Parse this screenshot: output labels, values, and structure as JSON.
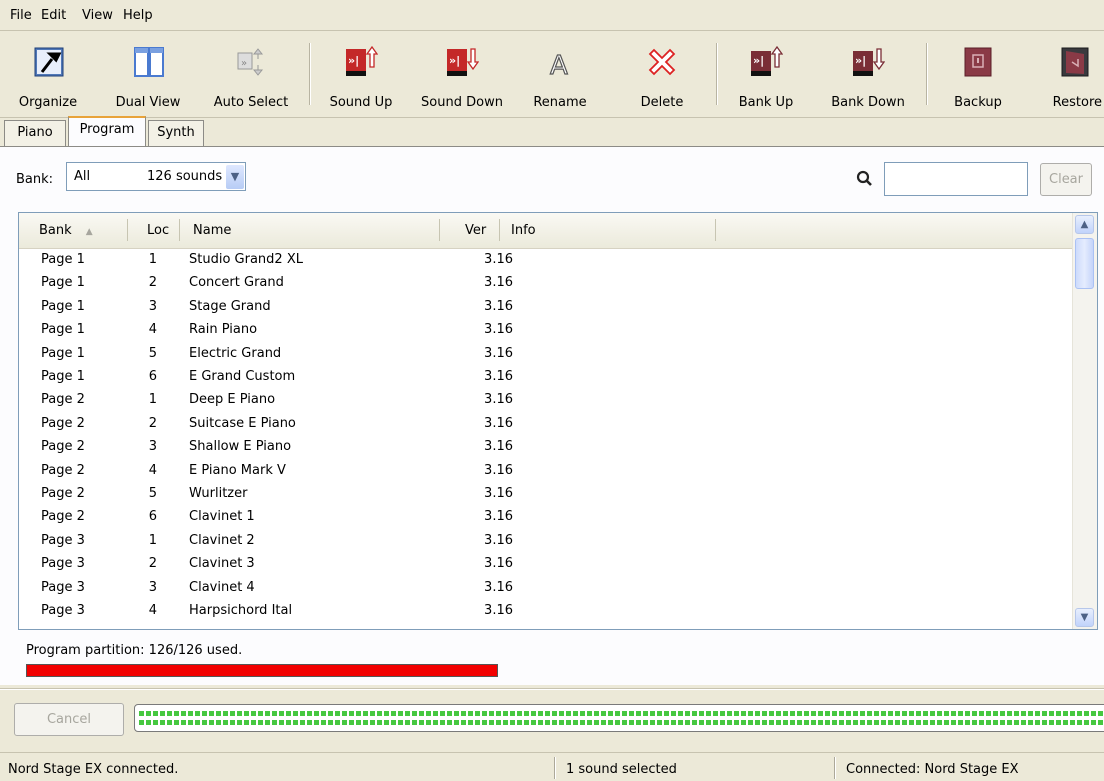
{
  "menu": [
    "File",
    "Edit",
    "View",
    "Help"
  ],
  "toolbar": {
    "organize": "Organize",
    "dual_view": "Dual View",
    "auto_select": "Auto Select",
    "sound_up": "Sound Up",
    "sound_down": "Sound Down",
    "rename": "Rename",
    "delete": "Delete",
    "bank_up": "Bank Up",
    "bank_down": "Bank Down",
    "backup": "Backup",
    "restore": "Restore"
  },
  "tabs": [
    "Piano",
    "Program",
    "Synth"
  ],
  "active_tab": "Program",
  "bank": {
    "label": "Bank:",
    "value": "All",
    "count": "126 sounds"
  },
  "search": {
    "value": "",
    "clear_label": "Clear"
  },
  "table": {
    "columns": {
      "bank": "Bank",
      "loc": "Loc",
      "name": "Name",
      "ver": "Ver",
      "info": "Info"
    },
    "rows": [
      {
        "bank": "Page 1",
        "loc": "1",
        "name": "Studio Grand2 XL",
        "ver": "3.16",
        "info": ""
      },
      {
        "bank": "Page 1",
        "loc": "2",
        "name": "Concert Grand",
        "ver": "3.16",
        "info": ""
      },
      {
        "bank": "Page 1",
        "loc": "3",
        "name": "Stage Grand",
        "ver": "3.16",
        "info": ""
      },
      {
        "bank": "Page 1",
        "loc": "4",
        "name": "Rain Piano",
        "ver": "3.16",
        "info": ""
      },
      {
        "bank": "Page 1",
        "loc": "5",
        "name": "Electric Grand",
        "ver": "3.16",
        "info": ""
      },
      {
        "bank": "Page 1",
        "loc": "6",
        "name": "E Grand Custom",
        "ver": "3.16",
        "info": ""
      },
      {
        "bank": "Page 2",
        "loc": "1",
        "name": "Deep E Piano",
        "ver": "3.16",
        "info": ""
      },
      {
        "bank": "Page 2",
        "loc": "2",
        "name": "Suitcase E Piano",
        "ver": "3.16",
        "info": ""
      },
      {
        "bank": "Page 2",
        "loc": "3",
        "name": "Shallow E Piano",
        "ver": "3.16",
        "info": ""
      },
      {
        "bank": "Page 2",
        "loc": "4",
        "name": "E Piano Mark V",
        "ver": "3.16",
        "info": ""
      },
      {
        "bank": "Page 2",
        "loc": "5",
        "name": "Wurlitzer",
        "ver": "3.16",
        "info": ""
      },
      {
        "bank": "Page 2",
        "loc": "6",
        "name": "Clavinet 1",
        "ver": "3.16",
        "info": ""
      },
      {
        "bank": "Page 3",
        "loc": "1",
        "name": "Clavinet 2",
        "ver": "3.16",
        "info": ""
      },
      {
        "bank": "Page 3",
        "loc": "2",
        "name": "Clavinet 3",
        "ver": "3.16",
        "info": ""
      },
      {
        "bank": "Page 3",
        "loc": "3",
        "name": "Clavinet 4",
        "ver": "3.16",
        "info": ""
      },
      {
        "bank": "Page 3",
        "loc": "4",
        "name": "Harpsichord Ital",
        "ver": "3.16",
        "info": ""
      }
    ]
  },
  "partition": {
    "text": "Program partition: 126/126 used.",
    "used_fraction": 1.0,
    "color": "#f20000"
  },
  "cancel_label": "Cancel",
  "status": {
    "left": "Nord Stage EX connected.",
    "middle": "1 sound selected",
    "right": "Connected: Nord Stage EX"
  },
  "colors": {
    "progress_dots": "#46c840",
    "window_bg": "#ece9d8"
  }
}
